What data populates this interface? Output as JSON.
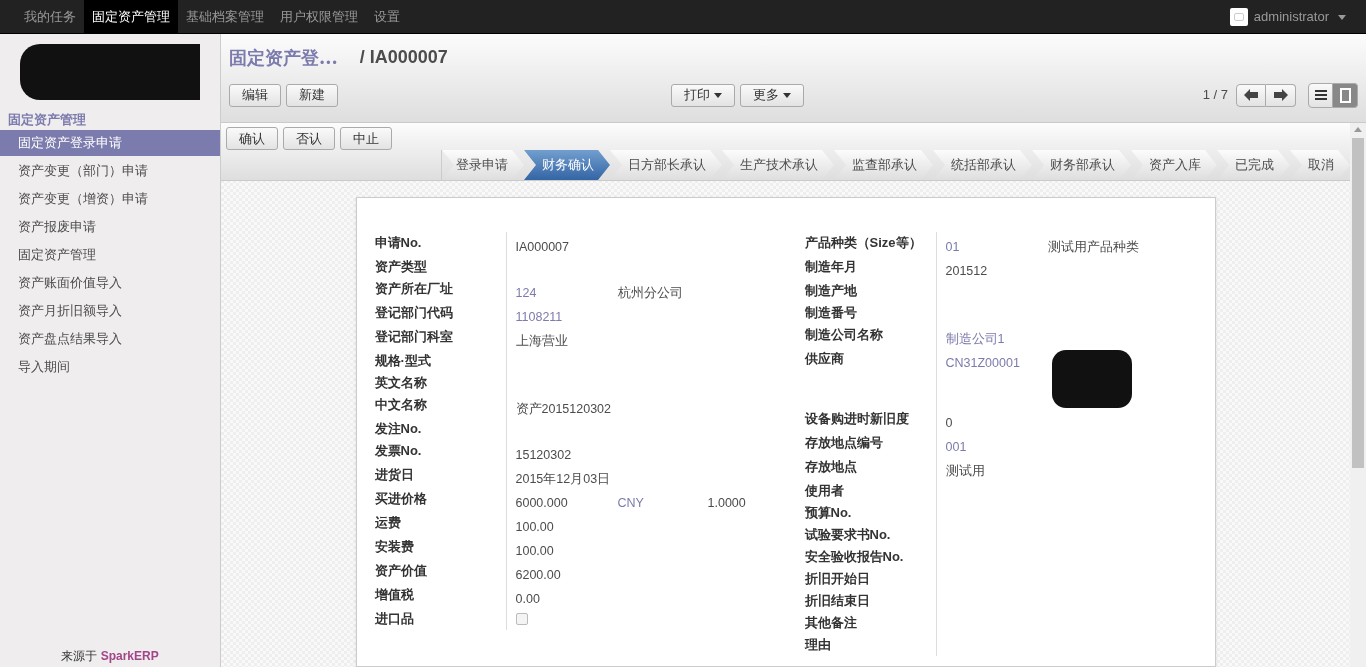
{
  "top_menu": [
    {
      "label": "我的任务",
      "selected": false
    },
    {
      "label": "固定资产管理",
      "selected": true
    },
    {
      "label": "基础档案管理",
      "selected": false
    },
    {
      "label": "用户权限管理",
      "selected": false
    },
    {
      "label": "设置",
      "selected": false
    }
  ],
  "user": {
    "name": "administrator"
  },
  "sidebar": {
    "section": "固定资产管理",
    "items": [
      {
        "label": "固定资产登录申请",
        "selected": true
      },
      {
        "label": "资产变更（部门）申请",
        "selected": false
      },
      {
        "label": "资产变更（增资）申请",
        "selected": false
      },
      {
        "label": "资产报废申请",
        "selected": false
      },
      {
        "label": "固定资产管理",
        "selected": false
      },
      {
        "label": "资产账面价值导入",
        "selected": false
      },
      {
        "label": "资产月折旧额导入",
        "selected": false
      },
      {
        "label": "资产盘点结果导入",
        "selected": false
      },
      {
        "label": "导入期间",
        "selected": false
      }
    ],
    "footer_prefix": "来源于",
    "footer_brand": "SparkERP"
  },
  "breadcrumb": {
    "parent": "固定资产登...",
    "current": "/ IA000007"
  },
  "buttons": [
    "编辑",
    "新建"
  ],
  "dropdowns": [
    "打印",
    "更多"
  ],
  "pager": "1 / 7",
  "view_switch": [
    {
      "kind": "list",
      "selected": false
    },
    {
      "kind": "form",
      "selected": true
    }
  ],
  "actions": [
    "确认",
    "否认",
    "中止"
  ],
  "steps": [
    {
      "label": "登录申请",
      "selected": false
    },
    {
      "label": "财务确认",
      "selected": true
    },
    {
      "label": "日方部长承认",
      "selected": false
    },
    {
      "label": "生产技术承认",
      "selected": false
    },
    {
      "label": "监查部承认",
      "selected": false
    },
    {
      "label": "统括部承认",
      "selected": false
    },
    {
      "label": "财务部承认",
      "selected": false
    },
    {
      "label": "资产入库",
      "selected": false
    },
    {
      "label": "已完成",
      "selected": false
    },
    {
      "label": "取消",
      "selected": false
    }
  ],
  "left_fields": [
    {
      "label": "申请No.",
      "kind": "text",
      "values": [
        {
          "text": "IA000007",
          "link": false
        }
      ]
    },
    {
      "label": "资产类型",
      "kind": "text"
    },
    {
      "label": "资产所在厂址",
      "kind": "text",
      "values": [
        {
          "text": "124",
          "link": true
        },
        {
          "text": "杭州分公司",
          "link": false
        }
      ]
    },
    {
      "label": "登记部门代码",
      "kind": "text",
      "values": [
        {
          "text": "1108211",
          "link": true
        }
      ]
    },
    {
      "label": "登记部门科室",
      "kind": "text",
      "values": [
        {
          "text": "上海营业",
          "link": false
        }
      ]
    },
    {
      "label": "规格·型式",
      "kind": "text"
    },
    {
      "label": "英文名称",
      "kind": "text"
    },
    {
      "label": "中文名称",
      "kind": "text",
      "values": [
        {
          "text": "资产2015120302",
          "link": false
        }
      ]
    },
    {
      "label": "发注No.",
      "kind": "text"
    },
    {
      "label": "发票No.",
      "kind": "text",
      "values": [
        {
          "text": "15120302",
          "link": false
        }
      ]
    },
    {
      "label": "进货日",
      "kind": "text",
      "values": [
        {
          "text": "2015年12月03日",
          "link": false
        }
      ]
    },
    {
      "label": "买进价格",
      "kind": "text",
      "values": [
        {
          "text": "6000.000",
          "link": false
        },
        {
          "text": "CNY",
          "link": true
        },
        {
          "text": "1.0000",
          "link": false
        }
      ]
    },
    {
      "label": "运费",
      "kind": "text",
      "values": [
        {
          "text": "100.00",
          "link": false
        }
      ]
    },
    {
      "label": "安装费",
      "kind": "text",
      "values": [
        {
          "text": "100.00",
          "link": false
        }
      ]
    },
    {
      "label": "资产价值",
      "kind": "text",
      "values": [
        {
          "text": "6200.00",
          "link": false
        }
      ]
    },
    {
      "label": "增值税",
      "kind": "text",
      "values": [
        {
          "text": "0.00",
          "link": false
        }
      ]
    },
    {
      "label": "进口品",
      "kind": "checkbox",
      "checked": false
    }
  ],
  "right_fields": [
    {
      "label": "产品种类（Size等）",
      "kind": "text",
      "values": [
        {
          "text": "01",
          "link": true
        },
        {
          "text": "测试用产品种类",
          "link": false
        }
      ]
    },
    {
      "label": "制造年月",
      "kind": "text",
      "values": [
        {
          "text": "201512",
          "link": false
        }
      ]
    },
    {
      "label": "制造产地",
      "kind": "text"
    },
    {
      "label": "制造番号",
      "kind": "text"
    },
    {
      "label": "制造公司名称",
      "kind": "text",
      "values": [
        {
          "text": "制造公司1",
          "link": true
        }
      ]
    },
    {
      "label": "供应商",
      "kind": "redacted",
      "values": [
        {
          "text": "CN31Z00001",
          "link": true
        }
      ]
    },
    {
      "label": "设备购进时新旧度",
      "kind": "text",
      "values": [
        {
          "text": "0",
          "link": false
        }
      ]
    },
    {
      "label": "存放地点编号",
      "kind": "text",
      "values": [
        {
          "text": "001",
          "link": true
        }
      ]
    },
    {
      "label": "存放地点",
      "kind": "text",
      "values": [
        {
          "text": "测试用",
          "link": false
        }
      ]
    },
    {
      "label": "使用者",
      "kind": "text"
    },
    {
      "label": "预算No.",
      "kind": "text"
    },
    {
      "label": "试验要求书No.",
      "kind": "text"
    },
    {
      "label": "安全验收报告No.",
      "kind": "text"
    },
    {
      "label": "折旧开始日",
      "kind": "text"
    },
    {
      "label": "折旧结束日",
      "kind": "text"
    },
    {
      "label": "其他备注",
      "kind": "text"
    },
    {
      "label": "理由",
      "kind": "text"
    }
  ]
}
